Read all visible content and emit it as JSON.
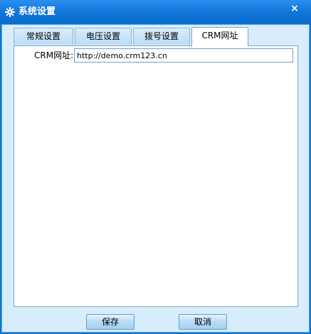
{
  "window": {
    "title": "系统设置",
    "close_label": "×"
  },
  "tabs": [
    {
      "label": "常规设置",
      "active": false
    },
    {
      "label": "电压设置",
      "active": false
    },
    {
      "label": "拨号设置",
      "active": false
    },
    {
      "label": "CRM网址",
      "active": true
    }
  ],
  "crm": {
    "label": "CRM网址:",
    "value": "http://demo.crm123.cn"
  },
  "buttons": {
    "save_label": "保存",
    "cancel_label": "取消"
  },
  "colors": {
    "titlebar": "#0d74d9",
    "client_bg": "#d8edfb",
    "panel_bg": "#ffffff"
  }
}
